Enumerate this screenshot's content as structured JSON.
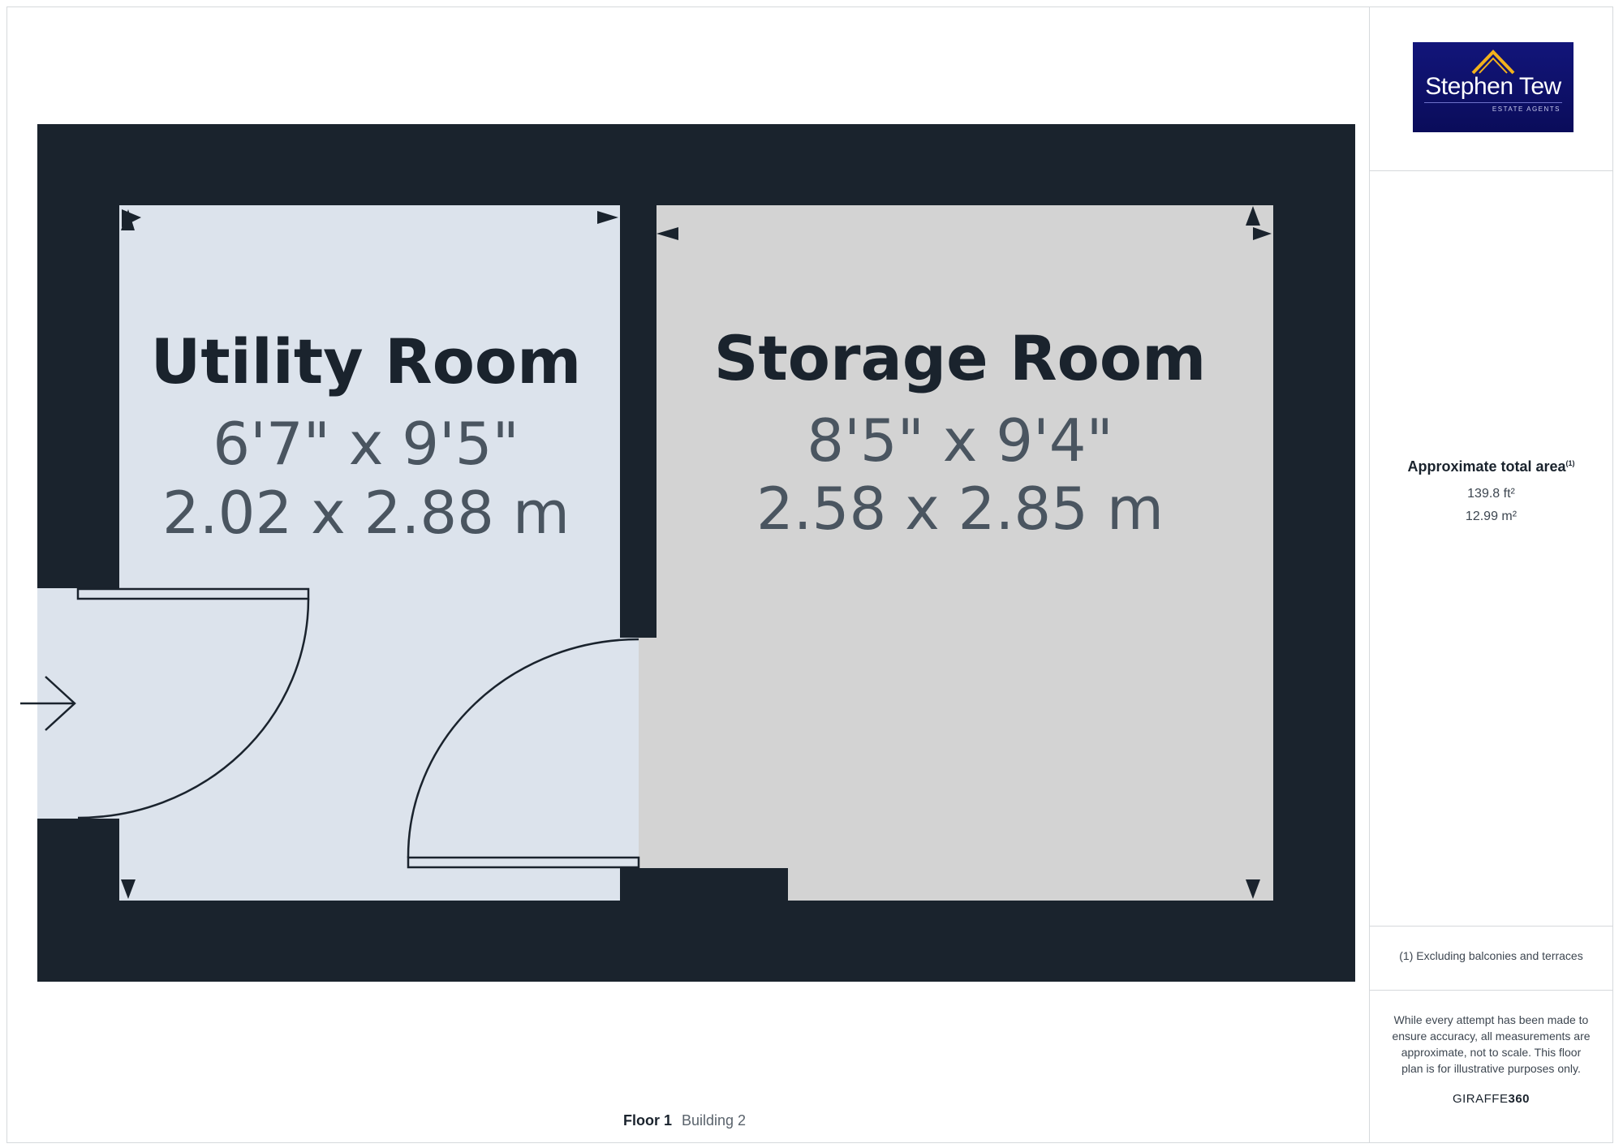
{
  "plan": {
    "rooms": [
      {
        "name": "Utility Room",
        "dim_imperial": "6'7\" x 9'5\"",
        "dim_metric": "2.02 x 2.88 m"
      },
      {
        "name": "Storage Room",
        "dim_imperial": "8'5\" x 9'4\"",
        "dim_metric": "2.58 x 2.85 m"
      }
    ],
    "floor_label": "Floor 1",
    "building_label": "Building 2"
  },
  "sidebar": {
    "logo_name": "Stephen Tew",
    "logo_sub": "ESTATE AGENTS",
    "area_title": "Approximate total area",
    "area_note_marker": "(1)",
    "area_ft": "139.8 ft²",
    "area_m": "12.99 m²",
    "footnote": "(1) Excluding balconies and terraces",
    "disclaimer": "While every attempt has been made to ensure accuracy, all measurements are approximate, not to scale. This floor plan is for illustrative purposes only.",
    "brand_light": "GIRAFFE",
    "brand_bold": "360"
  },
  "colors": {
    "wall": "#1a232d",
    "utility_fill": "#dce3ec",
    "storage_fill": "#d3d3d3",
    "logo_bg": "#0d1068"
  }
}
